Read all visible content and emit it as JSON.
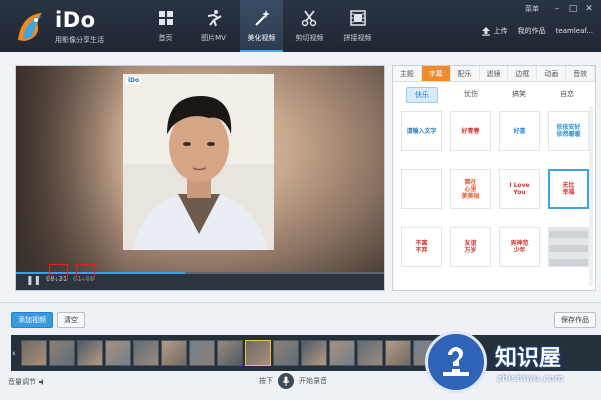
{
  "app": {
    "title": "iDo",
    "slogan": "用影像分享生活",
    "menu": "菜单",
    "upload": "上传",
    "my_works": "我的作品",
    "username": "teamleaf..."
  },
  "nav": [
    {
      "label": "首页",
      "icon": "grid-icon"
    },
    {
      "label": "图片MV",
      "icon": "figure-icon"
    },
    {
      "label": "美化视频",
      "icon": "magic-wand-icon",
      "active": true
    },
    {
      "label": "剪切视频",
      "icon": "scissors-icon"
    },
    {
      "label": "拼接视频",
      "icon": "film-icon"
    }
  ],
  "player": {
    "current_time": "00:31",
    "total_time": "01:08",
    "progress_fraction": 0.46,
    "photo_logo": "iDo"
  },
  "panel": {
    "tabs": [
      {
        "label": "主题"
      },
      {
        "label": "字幕",
        "active": true
      },
      {
        "label": "配乐"
      },
      {
        "label": "滤镜"
      },
      {
        "label": "边框"
      },
      {
        "label": "动画"
      },
      {
        "label": "音效"
      }
    ],
    "subtabs": [
      {
        "label": "快乐",
        "active": true
      },
      {
        "label": "忧伤"
      },
      {
        "label": "搞笑"
      },
      {
        "label": "自恋"
      }
    ],
    "stickers": [
      {
        "text": "请输入文字",
        "color": "#2a7fc4"
      },
      {
        "text": "好青春",
        "color": "#d2342c"
      },
      {
        "text": "好喜",
        "color": "#2a8fd6"
      },
      {
        "text": "依依安好\n依然暖暖",
        "color": "#2a8fd6"
      },
      {
        "text": "",
        "color": "#e4572e"
      },
      {
        "text": "窝在\n心里\n美美哒",
        "color": "#e4572e"
      },
      {
        "text": "I Love\nYou",
        "color": "#d2342c"
      },
      {
        "text": "无比\n幸福",
        "color": "#d2342c",
        "selected": true
      },
      {
        "text": "不离\n不弃",
        "color": "#d2342c"
      },
      {
        "text": "友谊\n万岁",
        "color": "#d2342c"
      },
      {
        "text": "男神范\n少年",
        "color": "#d2342c"
      },
      {
        "text": "",
        "color": "#c9ccd0",
        "pixelated": true
      }
    ]
  },
  "bottom": {
    "add_video": "添加视频",
    "clear": "清空",
    "save": "保存作品",
    "volume_label": "音量调节",
    "press_label": "按下",
    "record_label": "开始录音",
    "thumbnails": 16
  },
  "watermark": {
    "title": "知识屋",
    "subtitle": "zhishiwu.com"
  },
  "colors": {
    "accent": "#39a3e6",
    "tab_active": "#f08a2c",
    "topbar": "#242d3a"
  }
}
